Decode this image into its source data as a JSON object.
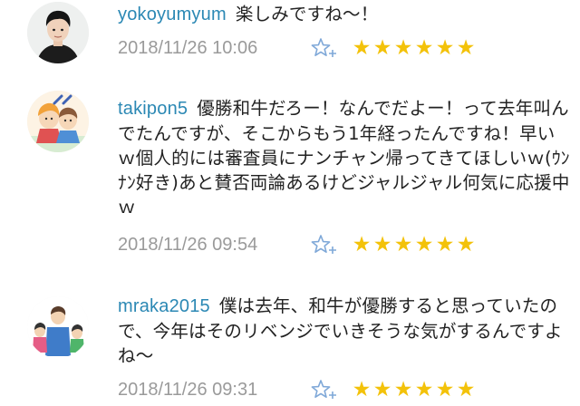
{
  "comments": [
    {
      "user": "yokoyumyum",
      "text": "楽しみですね～！",
      "time": "2018/11/26 10:06",
      "stars": 6,
      "avatar_icon": "profile-photo-avatar"
    },
    {
      "user": "takipon5",
      "text": "優勝和牛だろー！なんでだよー！って去年叫んでたんですが、そこからもう1年経ったんですね！早いｗ個人的には審査員にナンチャン帰ってきてほしいｗ(ｳﾝﾅﾝ好き)あと賛否両論あるけどジャルジャル何気に応援中ｗ",
      "time": "2018/11/26 09:54",
      "stars": 6,
      "avatar_icon": "illustrated-avatar"
    },
    {
      "user": "mraka2015",
      "text": "僕は去年、和牛が優勝すると思っていたので、今年はそのリベンジでいきそうな気がするんですよね～",
      "time": "2018/11/26 09:31",
      "stars": 6,
      "avatar_icon": "family-illustration-avatar"
    }
  ],
  "colors": {
    "username": "#2b88b4",
    "timestamp": "#9a9a9a",
    "star": "#f3c20a",
    "add_star_icon": "#7fa8d8"
  }
}
